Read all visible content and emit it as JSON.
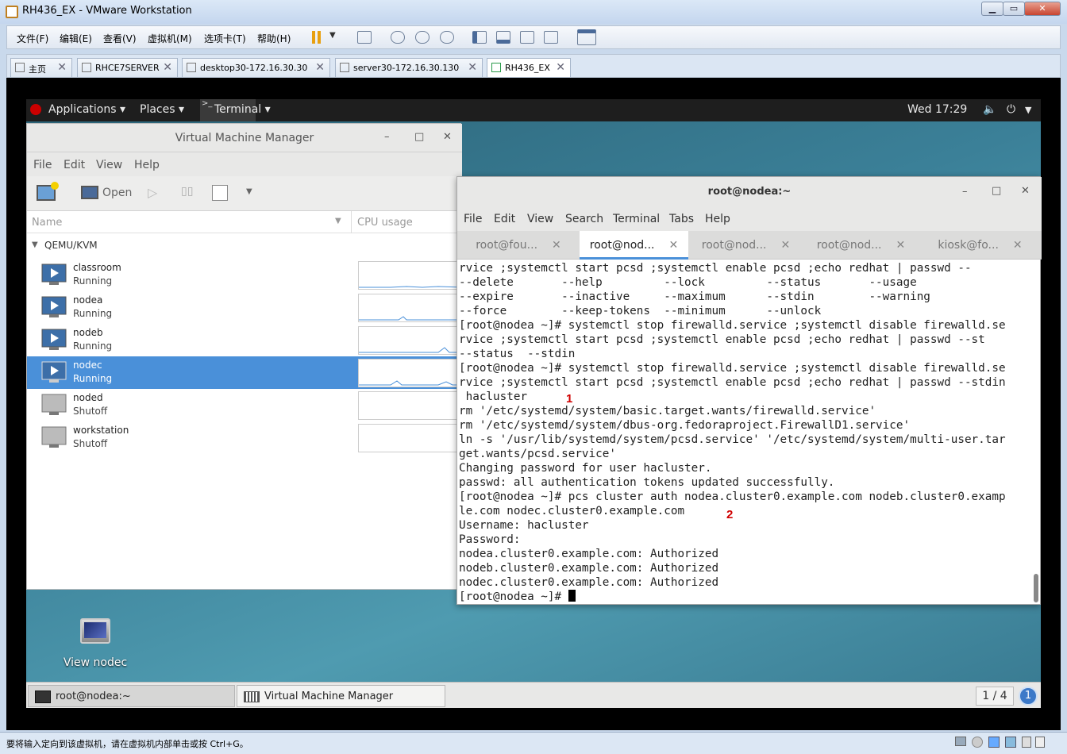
{
  "vmware": {
    "title": "RH436_EX - VMware Workstation",
    "menu": [
      "文件(F)",
      "编辑(E)",
      "查看(V)",
      "虚拟机(M)",
      "选项卡(T)",
      "帮助(H)"
    ],
    "tabs": [
      "主页",
      "RHCE7SERVER",
      "desktop30-172.16.30.30",
      "server30-172.16.30.130",
      "RH436_EX"
    ],
    "status": "要将输入定向到该虚拟机，请在虚拟机内部单击或按 Ctrl+G。"
  },
  "gnome": {
    "applications": "Applications",
    "places": "Places",
    "terminal": "Terminal",
    "clock": "Wed 17:29",
    "workspace": "1 / 4",
    "workspace_badge": "1"
  },
  "desktop_icon": {
    "label": "View nodec"
  },
  "taskbar": [
    "root@nodea:~",
    "Virtual Machine Manager"
  ],
  "vmm": {
    "title": "Virtual Machine Manager",
    "menu": [
      "File",
      "Edit",
      "View",
      "Help"
    ],
    "open_label": "Open",
    "col_name": "Name",
    "col_cpu": "CPU usage",
    "group": "QEMU/KVM",
    "vms": [
      {
        "name": "classroom",
        "state": "Running"
      },
      {
        "name": "nodea",
        "state": "Running"
      },
      {
        "name": "nodeb",
        "state": "Running"
      },
      {
        "name": "nodec",
        "state": "Running"
      },
      {
        "name": "noded",
        "state": "Shutoff"
      },
      {
        "name": "workstation",
        "state": "Shutoff"
      }
    ]
  },
  "terminal": {
    "title": "root@nodea:~",
    "menu": [
      "File",
      "Edit",
      "View",
      "Search",
      "Terminal",
      "Tabs",
      "Help"
    ],
    "tabs": [
      "root@fou...",
      "root@nod...",
      "root@nod...",
      "root@nod...",
      "kiosk@fo..."
    ],
    "lines": [
      "rvice ;systemctl start pcsd ;systemctl enable pcsd ;echo redhat | passwd --",
      "--delete       --help         --lock         --status       --usage",
      "--expire       --inactive     --maximum      --stdin        --warning",
      "--force        --keep-tokens  --minimum      --unlock",
      "[root@nodea ~]# systemctl stop firewalld.service ;systemctl disable firewalld.se",
      "rvice ;systemctl start pcsd ;systemctl enable pcsd ;echo redhat | passwd --st",
      "--status  --stdin",
      "[root@nodea ~]# systemctl stop firewalld.service ;systemctl disable firewalld.se",
      "rvice ;systemctl start pcsd ;systemctl enable pcsd ;echo redhat | passwd --stdin",
      " hacluster",
      "rm '/etc/systemd/system/basic.target.wants/firewalld.service'",
      "rm '/etc/systemd/system/dbus-org.fedoraproject.FirewallD1.service'",
      "ln -s '/usr/lib/systemd/system/pcsd.service' '/etc/systemd/system/multi-user.tar",
      "get.wants/pcsd.service'",
      "Changing password for user hacluster.",
      "passwd: all authentication tokens updated successfully.",
      "[root@nodea ~]# pcs cluster auth nodea.cluster0.example.com nodeb.cluster0.examp",
      "le.com nodec.cluster0.example.com",
      "Username: hacluster",
      "Password:",
      "nodea.cluster0.example.com: Authorized",
      "nodeb.cluster0.example.com: Authorized",
      "nodec.cluster0.example.com: Authorized",
      "[root@nodea ~]# "
    ],
    "annotation_1": "1",
    "annotation_2": "2"
  }
}
